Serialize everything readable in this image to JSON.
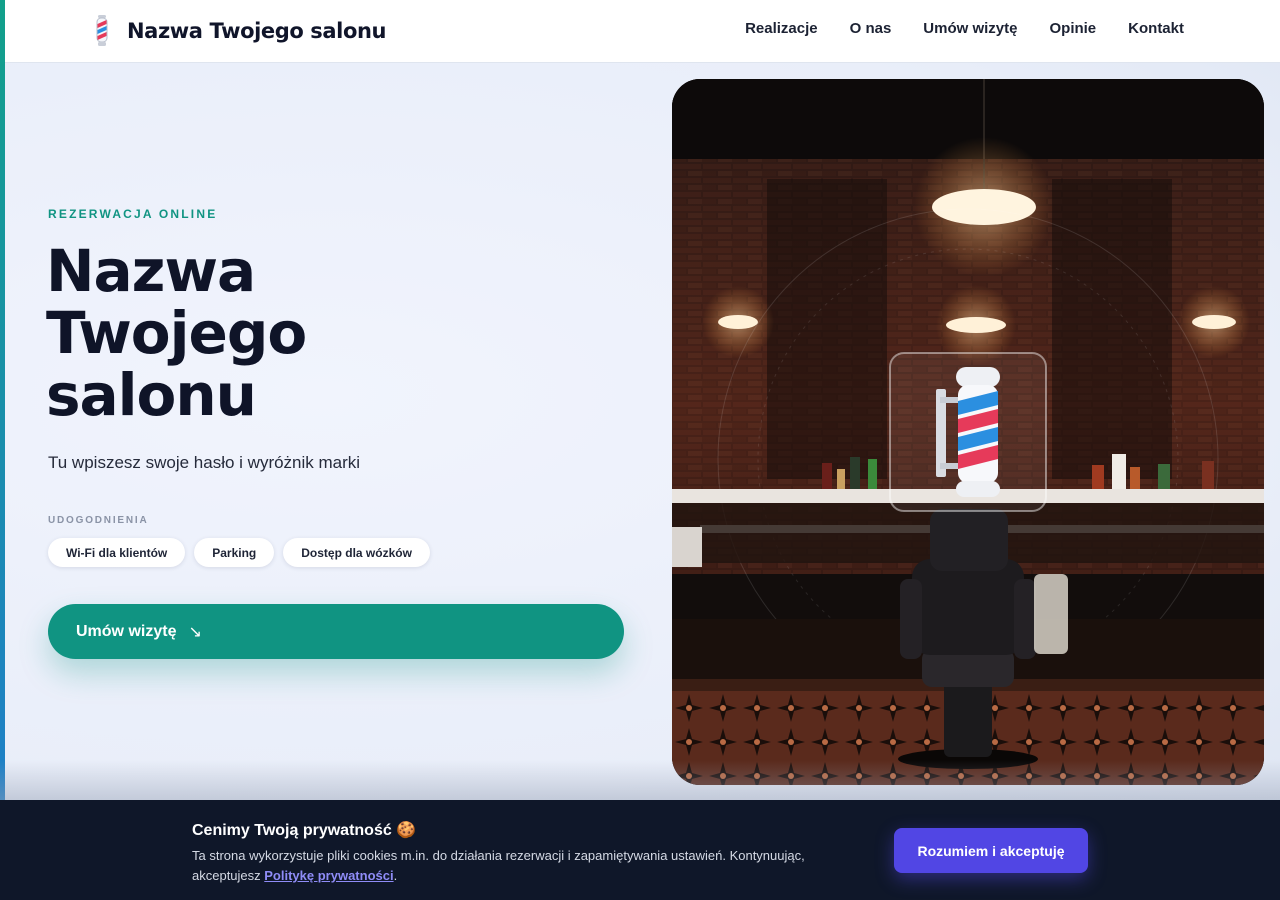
{
  "header": {
    "brand_name": "Nazwa Twojego salonu",
    "brand_icon": "barber-pole-icon",
    "nav": [
      "Realizacje",
      "O nas",
      "Umów wizytę",
      "Opinie",
      "Kontakt"
    ]
  },
  "hero": {
    "eyebrow": "REZERWACJA ONLINE",
    "title_lines": [
      "Nazwa",
      "Twojego",
      "salonu"
    ],
    "tagline": "Tu wpiszesz swoje hasło i wyróżnik marki",
    "amenities_label": "UDOGODNIENIA",
    "amenities": [
      "Wi-Fi dla klientów",
      "Parking",
      "Dostęp dla wózków"
    ],
    "cta_label": "Umów wizytę",
    "cta_icon": "arrow-down-right-icon",
    "cta_arrow": "↘"
  },
  "photo": {
    "subject": "barbershop-interior-image",
    "overlay_icon": "barber-pole-icon"
  },
  "cookie": {
    "title": "Cenimy Twoją prywatność 🍪",
    "text_before": "Ta strona wykorzystuje pliki cookies m.in. do działania rezerwacji i zapamiętywania ustawień. Kontynuując, akceptujesz ",
    "link_label": "Politykę prywatności",
    "text_after": ".",
    "accept_label": "Rozumiem i akceptuję"
  },
  "colors": {
    "accent": "#109482",
    "dark": "#0f1428",
    "cookie_bg": "#0f1729",
    "cookie_button": "#5146e4",
    "link": "#8f8cf7"
  }
}
